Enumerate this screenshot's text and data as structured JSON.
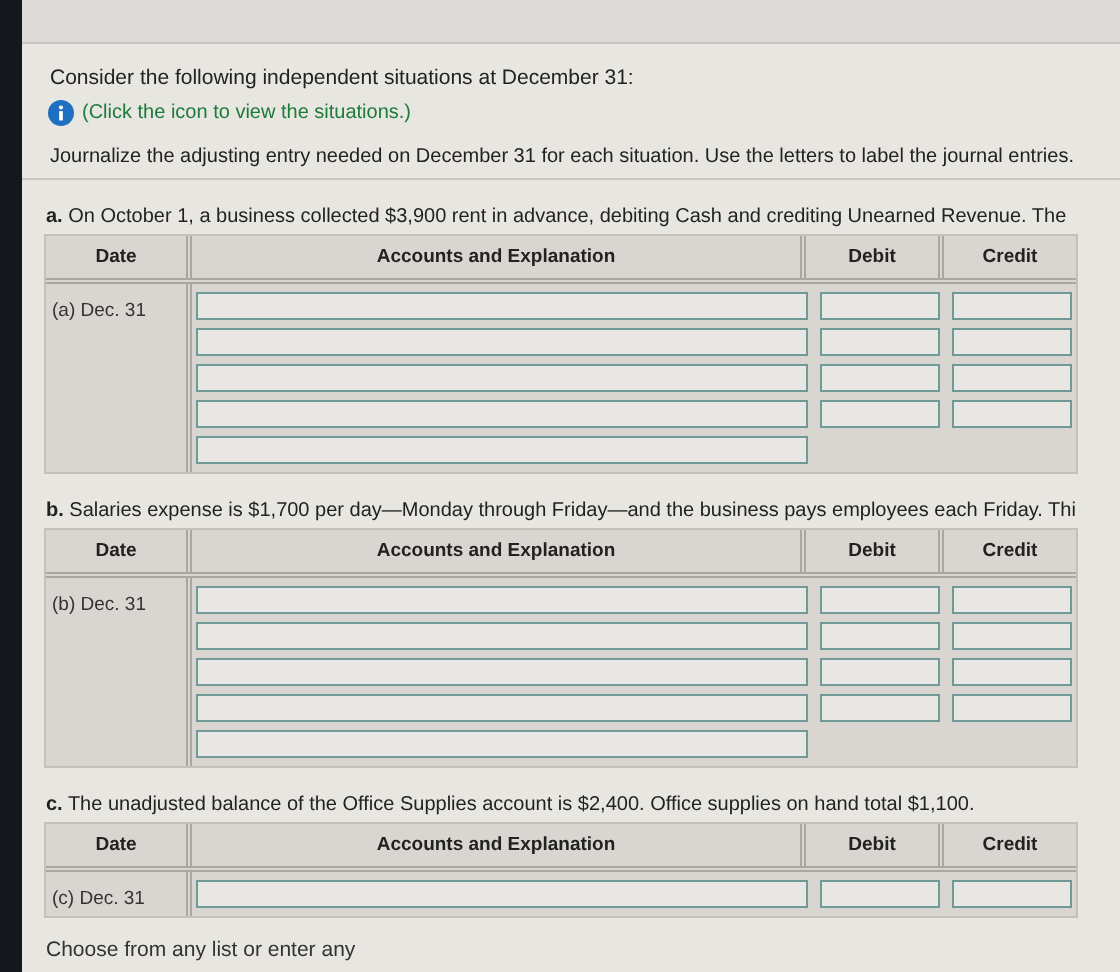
{
  "intro": "Consider the following independent situations at December 31:",
  "info_link": "(Click the icon to view the situations.)",
  "instruction": "Journalize the adjusting entry needed on December 31 for each situation. Use the letters to label the journal entries.",
  "sections": [
    {
      "prompt": "**a.** On October 1, a business collected $3,900 rent in advance, debiting Cash and crediting Unearned Revenue. The",
      "columns": [
        "Date",
        "Accounts and Explanation",
        "Debit",
        "Credit"
      ],
      "date": "(a) Dec. 31",
      "rows": [
        {
          "kind": "amount"
        },
        {
          "kind": "amount"
        },
        {
          "kind": "amount"
        },
        {
          "kind": "amount"
        },
        {
          "kind": "explanation"
        }
      ]
    },
    {
      "prompt": "**b.** Salaries expense is $1,700 per day—Monday through Friday—and the business pays employees each Friday. Thi",
      "columns": [
        "Date",
        "Accounts and Explanation",
        "Debit",
        "Credit"
      ],
      "date": "(b) Dec. 31",
      "rows": [
        {
          "kind": "amount"
        },
        {
          "kind": "amount"
        },
        {
          "kind": "amount"
        },
        {
          "kind": "amount"
        },
        {
          "kind": "explanation"
        }
      ]
    },
    {
      "prompt": "**c.** The unadjusted balance of the Office Supplies account is $2,400. Office supplies on hand total $1,100.",
      "columns": [
        "Date",
        "Accounts and Explanation",
        "Debit",
        "Credit"
      ],
      "date": "(c) Dec. 31",
      "rows": [
        {
          "kind": "amount"
        }
      ]
    }
  ],
  "footer": "Choose from any list or enter any"
}
